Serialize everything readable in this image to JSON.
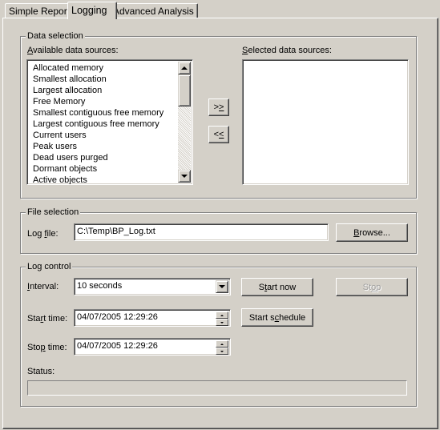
{
  "tabs": [
    {
      "label": "Simple Report",
      "active": false
    },
    {
      "label": "Logging",
      "active": true
    },
    {
      "label": "Advanced Analysis",
      "active": false
    }
  ],
  "data_selection": {
    "title": "Data selection",
    "available_label_accel": "A",
    "available_label_rest": "vailable data sources:",
    "selected_label_accel": "S",
    "selected_label_rest": "elected data sources:",
    "available_items": [
      "Allocated memory",
      "Smallest allocation",
      "Largest allocation",
      "Free Memory",
      "Smallest contiguous free memory",
      "Largest contiguous free memory",
      "Current users",
      "Peak users",
      "Dead users purged",
      "Dormant objects",
      "Active objects"
    ],
    "selected_items": [],
    "add_button": {
      "pre": ">",
      "accel": ">"
    },
    "remove_button": {
      "pre": "<",
      "accel": "<"
    }
  },
  "file_selection": {
    "title": "File selection",
    "log_file_label_pre": "Log ",
    "log_file_label_accel": "f",
    "log_file_label_post": "ile:",
    "log_file_value": "C:\\Temp\\BP_Log.txt",
    "browse_accel": "B",
    "browse_rest": "rowse..."
  },
  "log_control": {
    "title": "Log control",
    "interval_label_accel": "I",
    "interval_label_rest": "nterval:",
    "interval_value": "10 seconds",
    "start_now_pre": "S",
    "start_now_accel": "t",
    "start_now_post": "art now",
    "stop_pre": "St",
    "stop_accel": "o",
    "stop_post": "p",
    "stop_enabled": false,
    "start_time_label_pre": "Sta",
    "start_time_label_accel": "r",
    "start_time_label_post": "t time:",
    "start_time_value": "04/07/2005   12:29:26",
    "start_schedule_pre": "Start s",
    "start_schedule_accel": "c",
    "start_schedule_post": "hedule",
    "stop_time_label_pre": "Sto",
    "stop_time_label_accel": "p",
    "stop_time_label_post": " time:",
    "stop_time_value": "04/07/2005   12:29:26",
    "status_label": "Status:",
    "status_value": ""
  }
}
